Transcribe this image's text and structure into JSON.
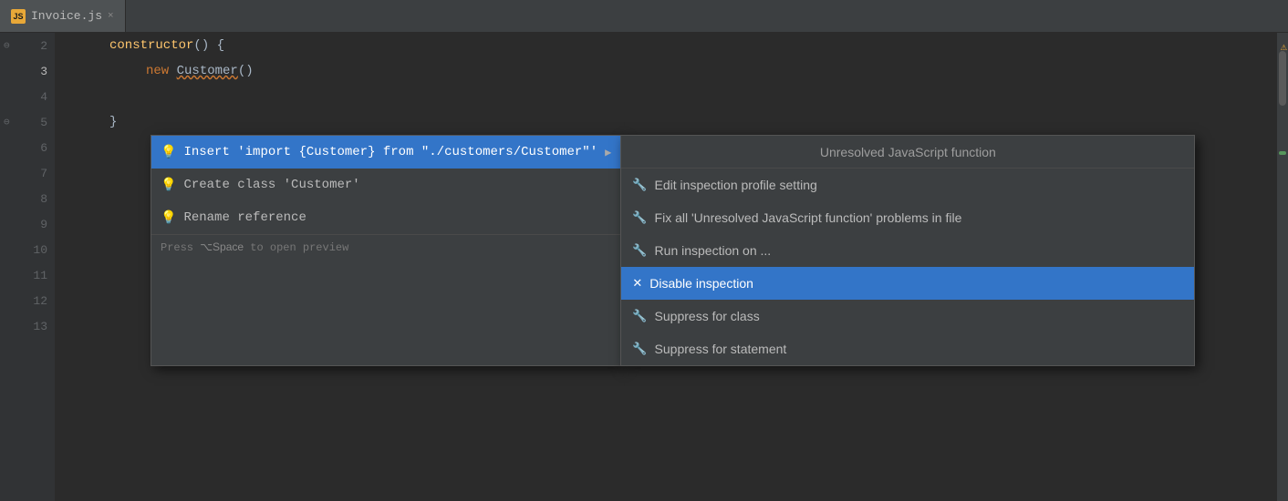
{
  "tab": {
    "icon_label": "JS",
    "filename": "Invoice.js",
    "close_label": "×"
  },
  "editor": {
    "lines": [
      {
        "number": "2",
        "indent": "indent1",
        "content_parts": [
          {
            "text": "constructor",
            "class": "kw-yellow"
          },
          {
            "text": "() {",
            "class": "kw-white"
          }
        ]
      },
      {
        "number": "3",
        "indent": "indent2",
        "content_parts": [
          {
            "text": "new ",
            "class": "kw-orange"
          },
          {
            "text": "Customer",
            "class": "kw-white underline-wavy"
          },
          {
            "text": "()",
            "class": "kw-white"
          }
        ]
      },
      {
        "number": "4",
        "indent": "",
        "content_parts": []
      },
      {
        "number": "5",
        "indent": "indent1",
        "content_parts": [
          {
            "text": "}",
            "class": "kw-white"
          }
        ]
      },
      {
        "number": "6",
        "indent": "",
        "content_parts": []
      },
      {
        "number": "7",
        "indent": "",
        "content_parts": []
      },
      {
        "number": "8",
        "indent": "",
        "content_parts": []
      },
      {
        "number": "9",
        "indent": "",
        "content_parts": []
      },
      {
        "number": "10",
        "indent": "",
        "content_parts": []
      },
      {
        "number": "11",
        "indent": "",
        "content_parts": []
      },
      {
        "number": "12",
        "indent": "",
        "content_parts": []
      },
      {
        "number": "13",
        "indent": "",
        "content_parts": []
      }
    ]
  },
  "quickfix_popup": {
    "items": [
      {
        "id": "insert-import",
        "icon": "💡",
        "label": "Insert 'import {Customer} from \"./customers/Customer\"'",
        "has_arrow": true,
        "selected": true
      },
      {
        "id": "create-class",
        "icon": "💡",
        "label": "Create class 'Customer'",
        "has_arrow": false,
        "selected": false
      },
      {
        "id": "rename-ref",
        "icon": "💡",
        "label": "Rename reference",
        "has_arrow": false,
        "selected": false
      }
    ],
    "hint": "Press ⌥Space to open preview"
  },
  "inspection_popup": {
    "header": "Unresolved JavaScript function",
    "items": [
      {
        "id": "edit-profile",
        "icon": "wrench",
        "label": "Edit inspection profile setting",
        "selected": false
      },
      {
        "id": "fix-all",
        "icon": "wrench",
        "label": "Fix all 'Unresolved JavaScript function' problems in file",
        "selected": false
      },
      {
        "id": "run-inspection",
        "icon": "wrench",
        "label": "Run inspection on ...",
        "selected": false
      },
      {
        "id": "disable-inspection",
        "icon": "x",
        "label": "Disable inspection",
        "selected": true
      },
      {
        "id": "suppress-class",
        "icon": "wrench",
        "label": "Suppress for class",
        "selected": false
      },
      {
        "id": "suppress-statement",
        "icon": "wrench",
        "label": "Suppress for statement",
        "selected": false
      }
    ]
  }
}
